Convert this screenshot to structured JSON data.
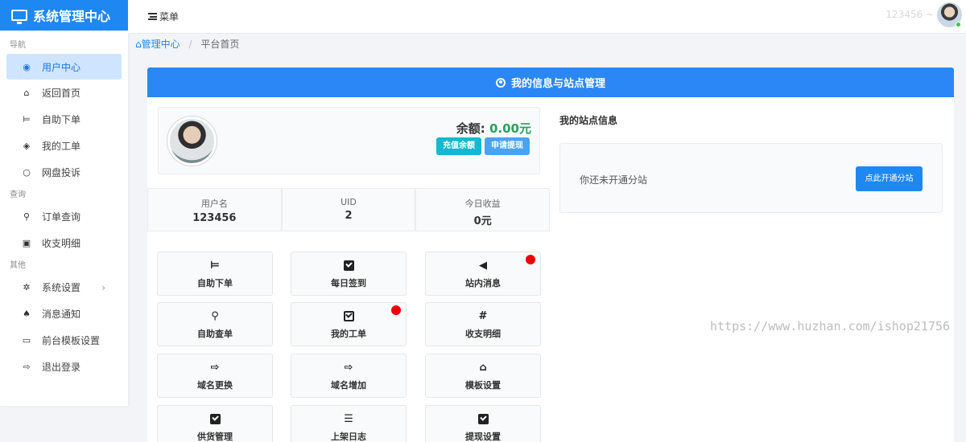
{
  "brand": {
    "title": "系统管理中心"
  },
  "topbar": {
    "menu_label": "菜单",
    "username": "123456 ~"
  },
  "sidebar": {
    "groups": [
      {
        "label": "导航",
        "items": [
          {
            "label": "用户中心",
            "icon": "user-circle-icon",
            "active": true
          },
          {
            "label": "返回首页",
            "icon": "home-icon"
          },
          {
            "label": "自助下单",
            "icon": "cart-icon"
          },
          {
            "label": "我的工单",
            "icon": "tag-icon"
          },
          {
            "label": "网盘投诉",
            "icon": "comment-icon"
          }
        ]
      },
      {
        "label": "查询",
        "items": [
          {
            "label": "订单查询",
            "icon": "search-icon"
          },
          {
            "label": "收支明细",
            "icon": "money-icon"
          }
        ]
      },
      {
        "label": "其他",
        "items": [
          {
            "label": "系统设置",
            "icon": "gear-icon",
            "chevron": "›"
          },
          {
            "label": "消息通知",
            "icon": "bell-icon"
          },
          {
            "label": "前台模板设置",
            "icon": "desktop-icon"
          },
          {
            "label": "退出登录",
            "icon": "sign-out-icon"
          }
        ]
      }
    ]
  },
  "breadcrumb": {
    "home": "管理中心",
    "separator": "/",
    "current": "平台首页"
  },
  "card": {
    "title": "我的信息与站点管理",
    "balance_label": "余额:",
    "balance_value": "0.00元",
    "recharge_label": "充值余额",
    "withdraw_label": "申请提现",
    "stats": [
      {
        "label": "用户名",
        "value": "123456"
      },
      {
        "label": "UID",
        "value": "2"
      },
      {
        "label": "今日收益",
        "value": "0元"
      }
    ],
    "tiles": [
      {
        "label": "自助下单",
        "icon": "cart-icon"
      },
      {
        "label": "每日签到",
        "icon": "check-square-icon"
      },
      {
        "label": "站内消息",
        "icon": "bullhorn-icon",
        "badge": true
      },
      {
        "label": "自助查单",
        "icon": "search-icon"
      },
      {
        "label": "我的工单",
        "icon": "check-square-outline-icon",
        "badge": true
      },
      {
        "label": "收支明细",
        "icon": "hash-icon"
      },
      {
        "label": "域名更换",
        "icon": "sign-out-icon"
      },
      {
        "label": "域名增加",
        "icon": "sign-out-icon"
      },
      {
        "label": "模板设置",
        "icon": "home-icon"
      },
      {
        "label": "供货管理",
        "icon": "check-square-icon"
      },
      {
        "label": "上架日志",
        "icon": "list-icon"
      },
      {
        "label": "提现设置",
        "icon": "check-square-icon"
      }
    ],
    "site_title": "我的站点信息",
    "site_text": "你还未开通分站",
    "site_button": "点此开通分站"
  },
  "watermark": "https://www.huzhan.com/ishop21756",
  "colors": {
    "brand": "#1e88f2",
    "header": "#2a87f5",
    "balance": "#22a45d",
    "badge": "#ee0000",
    "recharge": "#14b8d0"
  }
}
